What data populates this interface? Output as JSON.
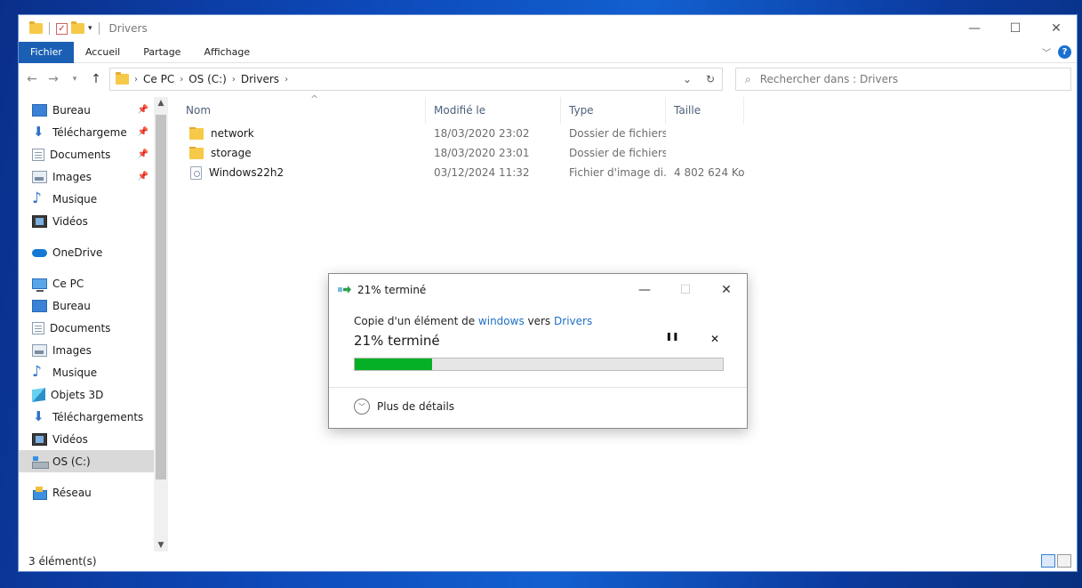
{
  "window": {
    "title": "Drivers",
    "minimize": "—",
    "maximize": "☐",
    "close": "✕"
  },
  "ribbon": {
    "tabs": [
      "Fichier",
      "Accueil",
      "Partage",
      "Affichage"
    ]
  },
  "address": {
    "crumbs": [
      "Ce PC",
      "OS (C:)",
      "Drivers"
    ],
    "search_placeholder": "Rechercher dans : Drivers"
  },
  "sidebar": {
    "quick_access": [
      {
        "label": "Bureau",
        "icon": "desktop-icon"
      },
      {
        "label": "Téléchargeme",
        "icon": "download-icon"
      },
      {
        "label": "Documents",
        "icon": "documents-icon"
      },
      {
        "label": "Images",
        "icon": "images-icon"
      },
      {
        "label": "Musique",
        "icon": "music-icon"
      },
      {
        "label": "Vidéos",
        "icon": "video-icon"
      }
    ],
    "onedrive": "OneDrive",
    "this_pc": "Ce PC",
    "pc_items": [
      {
        "label": "Bureau",
        "icon": "desktop-icon"
      },
      {
        "label": "Documents",
        "icon": "documents-icon"
      },
      {
        "label": "Images",
        "icon": "images-icon"
      },
      {
        "label": "Musique",
        "icon": "music-icon"
      },
      {
        "label": "Objets 3D",
        "icon": "cube-icon"
      },
      {
        "label": "Téléchargements",
        "icon": "download-icon"
      },
      {
        "label": "Vidéos",
        "icon": "video-icon"
      },
      {
        "label": "OS (C:)",
        "icon": "drive-icon"
      }
    ],
    "network": "Réseau"
  },
  "list": {
    "columns": [
      "Nom",
      "Modifié le",
      "Type",
      "Taille"
    ],
    "rows": [
      {
        "name": "network",
        "modified": "18/03/2020 23:02",
        "type": "Dossier de fichiers",
        "size": "",
        "kind": "folder"
      },
      {
        "name": "storage",
        "modified": "18/03/2020 23:01",
        "type": "Dossier de fichiers",
        "size": "",
        "kind": "folder"
      },
      {
        "name": "Windows22h2",
        "modified": "03/12/2024 11:32",
        "type": "Fichier d'image di...",
        "size": "4 802 624 Ko",
        "kind": "file"
      }
    ]
  },
  "status": {
    "count": "3 élément(s)"
  },
  "dialog": {
    "title": "21% terminé",
    "copy_prefix": "Copie d'un élément de ",
    "source": "windows",
    "copy_middle": " vers ",
    "destination": "Drivers",
    "percent_label": "21% terminé",
    "progress_pct": 21,
    "pause": "❚❚",
    "cancel": "✕",
    "details": "Plus de détails"
  },
  "colors": {
    "accent": "#1a5fb4",
    "progress": "#06b025",
    "link": "#1f6fc5"
  }
}
